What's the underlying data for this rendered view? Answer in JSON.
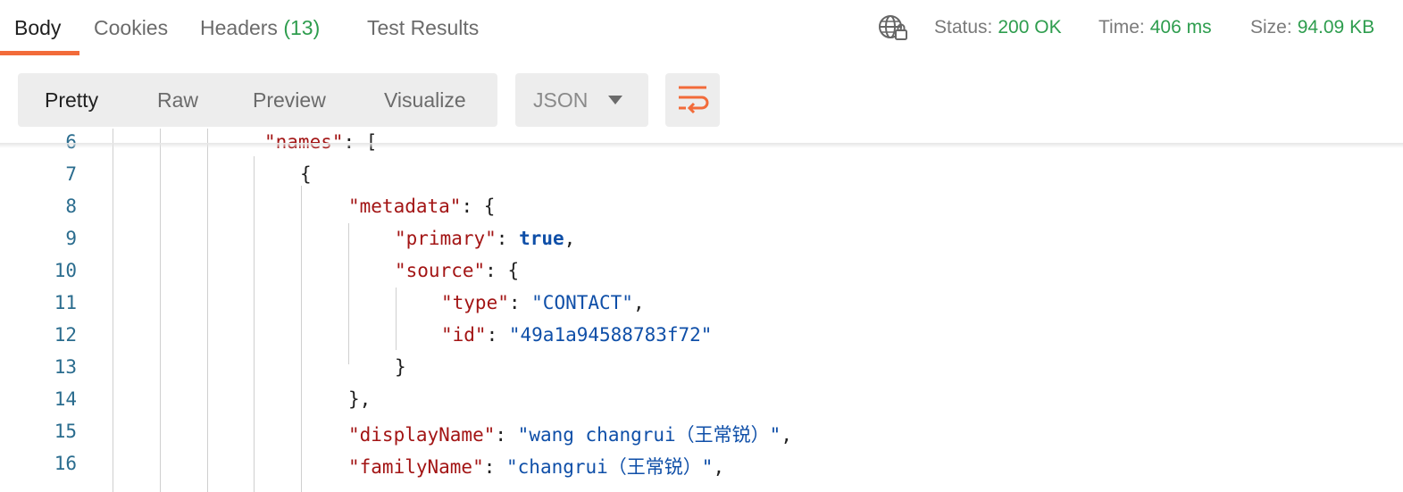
{
  "tabs": {
    "body": "Body",
    "cookies": "Cookies",
    "headers": "Headers",
    "headers_count": "(13)",
    "test_results": "Test Results"
  },
  "status": {
    "status_label": "Status:",
    "status_value": "200 OK",
    "time_label": "Time:",
    "time_value": "406 ms",
    "size_label": "Size:",
    "size_value": "94.09 KB",
    "globe_icon": "globe-lock-icon"
  },
  "toolbar": {
    "pretty": "Pretty",
    "raw": "Raw",
    "preview": "Preview",
    "visualize": "Visualize",
    "format": "JSON",
    "wrap_icon": "wrap-lines-icon"
  },
  "colors": {
    "accent": "#f26b3a",
    "status_green": "#2e9d4e",
    "json_key": "#a31515",
    "json_string": "#0f4fa8",
    "line_number": "#2a6c8e"
  },
  "code": {
    "line_numbers": [
      "6",
      "7",
      "8",
      "9",
      "10",
      "11",
      "12",
      "13",
      "14",
      "15",
      "16"
    ],
    "l6_key": "\"names\"",
    "l6_rest": ": [",
    "l7": "{",
    "l8_key": "\"metadata\"",
    "l8_rest": ": {",
    "l9_key": "\"primary\"",
    "l9_sep": ": ",
    "l9_val": "true",
    "l9_end": ",",
    "l10_key": "\"source\"",
    "l10_rest": ": {",
    "l11_key": "\"type\"",
    "l11_sep": ": ",
    "l11_val": "\"CONTACT\"",
    "l11_end": ",",
    "l12_key": "\"id\"",
    "l12_sep": ": ",
    "l12_val": "\"49a1a94588783f72\"",
    "l13": "}",
    "l14": "},",
    "l15_key": "\"displayName\"",
    "l15_sep": ": ",
    "l15_val": "\"wang changrui（王常锐）\"",
    "l15_end": ",",
    "l16_key": "\"familyName\"",
    "l16_sep": ": ",
    "l16_val": "\"changrui（王常锐）\"",
    "l16_end": ","
  }
}
